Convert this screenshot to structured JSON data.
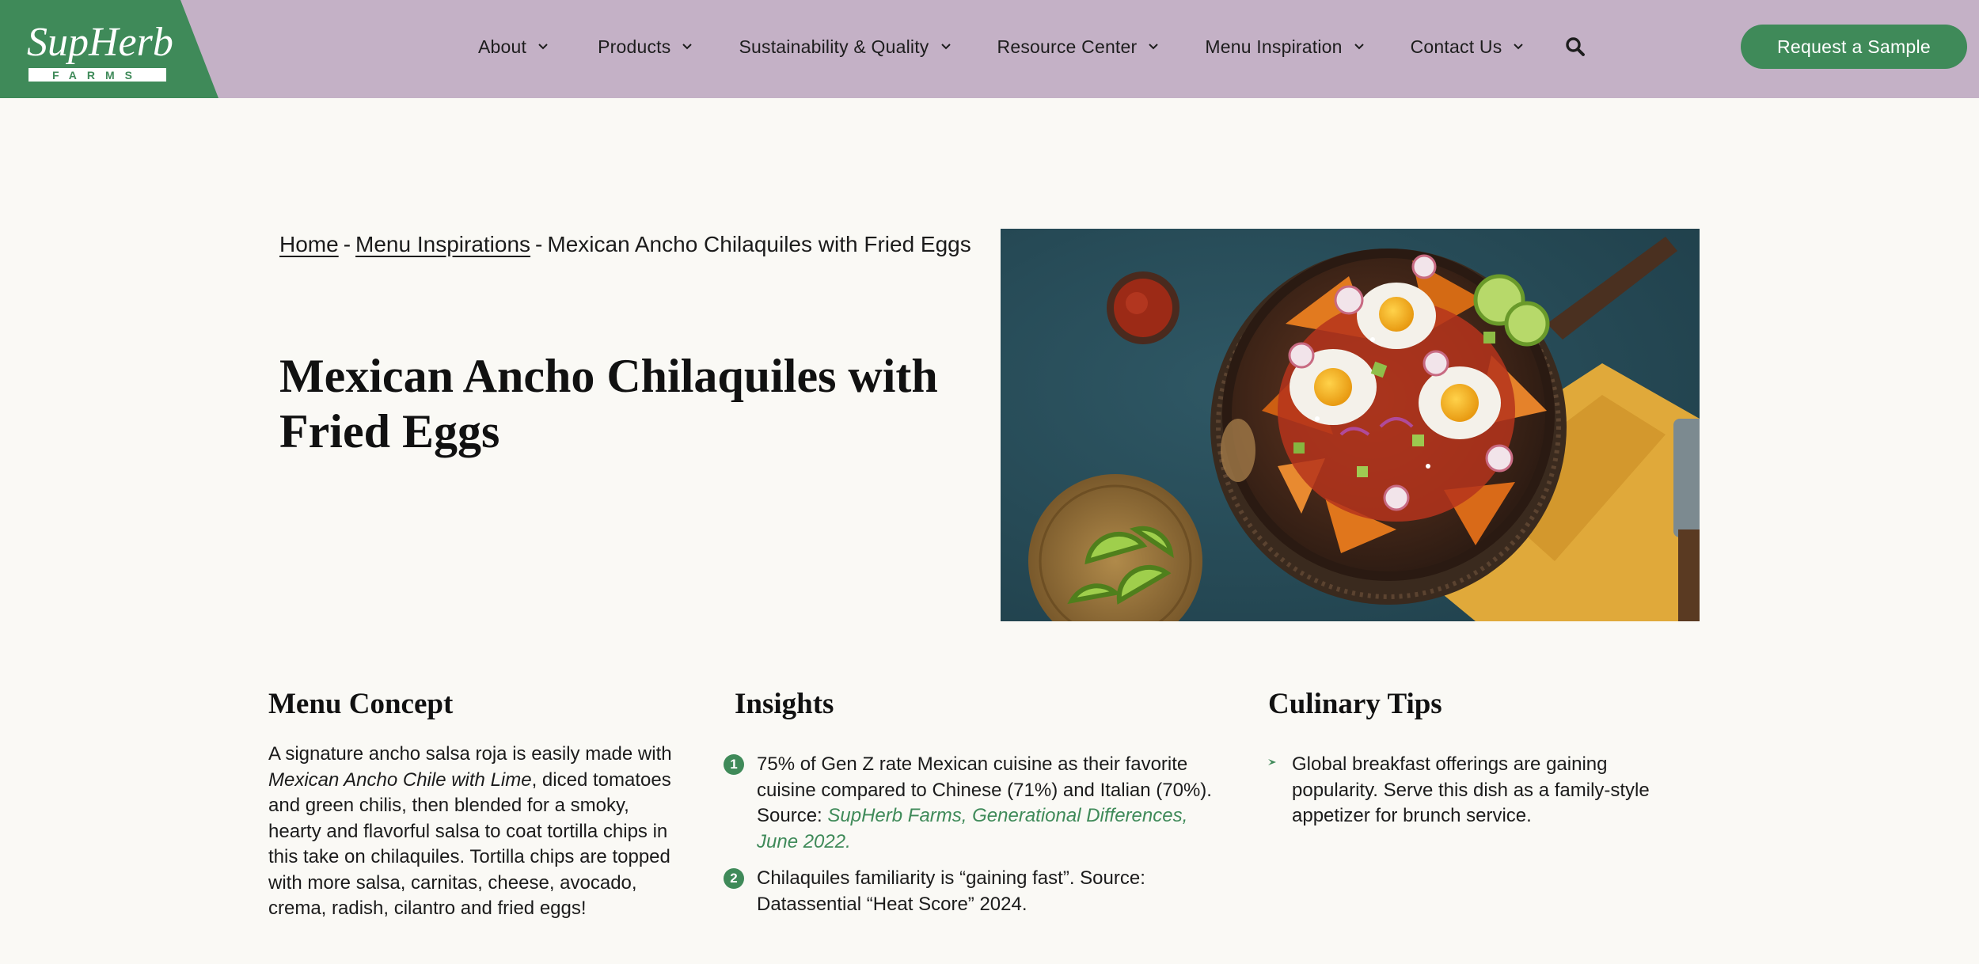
{
  "brand": {
    "logo_top": "SupHerb",
    "logo_bottom": "FARMS",
    "colors": {
      "header_bg": "#c4b1c6",
      "brand_green": "#3f8a59",
      "page_bg": "#faf9f5"
    }
  },
  "nav": {
    "items": [
      {
        "label": "About",
        "icon": "chevron-down-icon"
      },
      {
        "label": "Products",
        "icon": "chevron-down-icon"
      },
      {
        "label": "Sustainability & Quality",
        "icon": "chevron-down-icon"
      },
      {
        "label": "Resource Center",
        "icon": "chevron-down-icon"
      },
      {
        "label": "Menu Inspiration",
        "icon": "chevron-down-icon"
      },
      {
        "label": "Contact Us",
        "icon": "chevron-down-icon"
      }
    ],
    "search_icon": "search-icon",
    "cta_label": "Request a Sample"
  },
  "breadcrumb": {
    "home": "Home",
    "separator": "-",
    "menu_inspirations": "Menu Inspirations",
    "current": "Mexican Ancho Chilaquiles with Fried Eggs"
  },
  "hero": {
    "title": "Mexican Ancho Chilaquiles with Fried Eggs",
    "image_subject": "skillet of chilaquiles with fried eggs, salsa bowl and lime wedges"
  },
  "menu_concept": {
    "heading": "Menu Concept",
    "text_before": "A signature ancho salsa roja is easily made with ",
    "product_name": "Mexican Ancho Chile with Lime",
    "text_after": ", diced tomatoes and green chilis, then blended for a smoky, hearty and flavorful salsa to coat tortilla chips in this take on chilaquiles. Tortilla chips are topped with more salsa, carnitas, cheese, avocado, crema, radish, cilantro and fried eggs!"
  },
  "insights": {
    "heading": "Insights",
    "items": [
      {
        "number": "1",
        "text": "75% of Gen Z rate Mexican cuisine as their favorite cuisine compared to Chinese (71%) and Italian (70%). Source: ",
        "link": "SupHerb Farms, Generational Differences, June 2022."
      },
      {
        "number": "2",
        "text": "Chilaquiles familiarity is “gaining fast”. Source: Datassential “Heat Score” 2024."
      }
    ]
  },
  "culinary_tips": {
    "heading": "Culinary Tips",
    "items": [
      {
        "icon": "leaf-bullet-icon",
        "text": "Global breakfast offerings are gaining popularity. Serve this dish as a family-style appetizer for brunch service."
      }
    ]
  }
}
